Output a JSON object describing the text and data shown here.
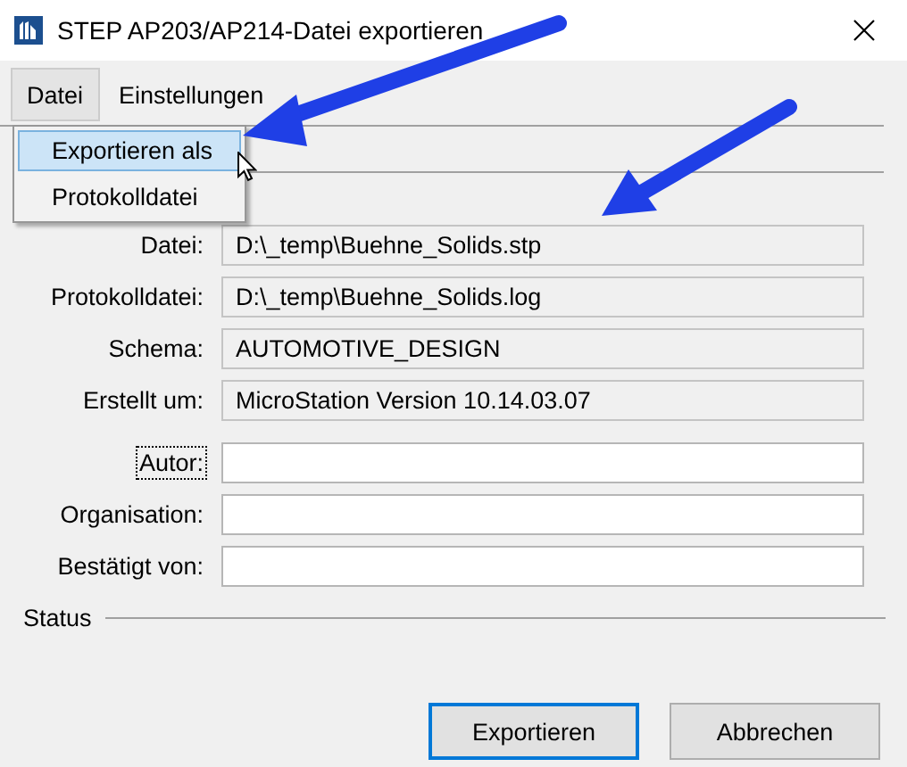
{
  "window": {
    "title": "STEP AP203/AP214-Datei exportieren"
  },
  "menu": [
    {
      "label": "Datei",
      "selected": true
    },
    {
      "label": "Einstellungen",
      "selected": false
    }
  ],
  "dropdown": [
    {
      "label": "Exportieren als",
      "selected": true
    },
    {
      "label": "Protokolldatei",
      "selected": false
    }
  ],
  "fields": [
    {
      "label": "Datei:",
      "value": "D:\\_temp\\Buehne_Solids.stp",
      "kind": "info",
      "focused": false
    },
    {
      "label": "Protokolldatei:",
      "value": "D:\\_temp\\Buehne_Solids.log",
      "kind": "info",
      "focused": false
    },
    {
      "label": "Schema:",
      "value": "AUTOMOTIVE_DESIGN",
      "kind": "info",
      "focused": false
    },
    {
      "label": "Erstellt um:",
      "value": "MicroStation Version 10.14.03.07",
      "kind": "info",
      "focused": false
    },
    {
      "label": "Autor:",
      "kind": "input",
      "focused": true
    },
    {
      "label": "Organisation:",
      "kind": "input",
      "focused": false
    },
    {
      "label": "Bestätigt von:",
      "kind": "input",
      "focused": false
    }
  ],
  "status": {
    "label": "Status"
  },
  "buttons": [
    {
      "label": "Exportieren",
      "default": true
    },
    {
      "label": "Abbrechen",
      "default": false
    }
  ]
}
